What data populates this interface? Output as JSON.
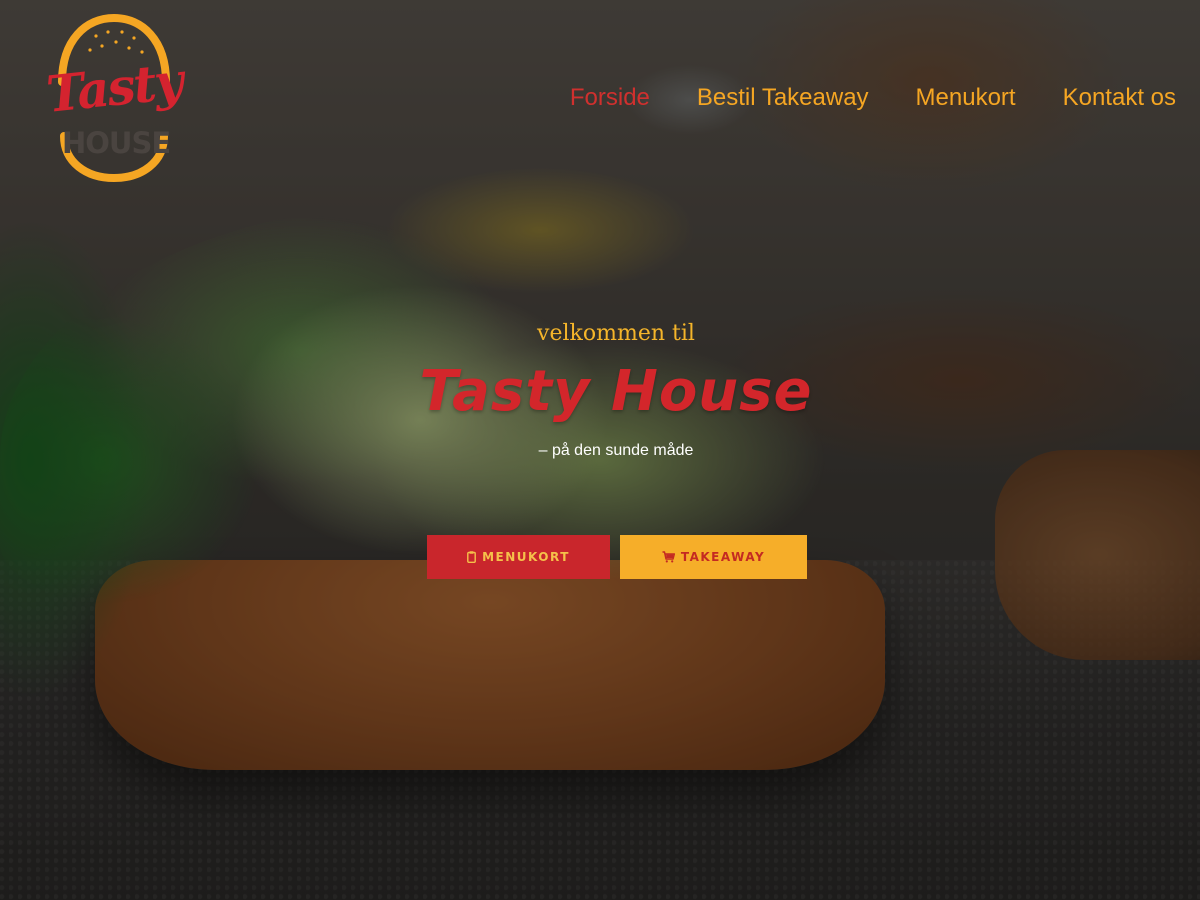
{
  "logo": {
    "line1": "Tasty",
    "line2": "HOUSE",
    "icon": "burger-bun-logo"
  },
  "nav": {
    "items": [
      {
        "label": "Forside",
        "active": true
      },
      {
        "label": "Bestil Takeaway",
        "active": false
      },
      {
        "label": "Menukort",
        "active": false
      },
      {
        "label": "Kontakt os",
        "active": false
      }
    ]
  },
  "hero": {
    "welcome": "velkommen til",
    "title": "Tasty House",
    "tagline": "– på den sunde måde",
    "buttons": {
      "menu": {
        "label": "MENUKORT",
        "icon": "clipboard-icon"
      },
      "takeaway": {
        "label": "TAKEAWAY",
        "icon": "cart-icon"
      }
    }
  },
  "colors": {
    "brand_red": "#d3262b",
    "brand_orange": "#f5a623",
    "nav_active": "#d0302e"
  }
}
